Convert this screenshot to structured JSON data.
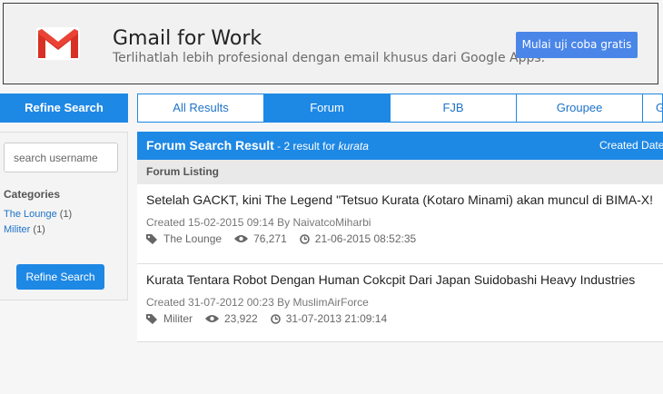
{
  "ad": {
    "title": "Gmail for Work",
    "subtitle": "Terlihatlah lebih profesional dengan email khusus dari Google Apps.",
    "cta": "Mulai uji coba gratis",
    "logo_icon": "gmail-logo"
  },
  "sidebar": {
    "header": "Refine Search",
    "search_placeholder": "search username",
    "categories_title": "Categories",
    "categories": [
      {
        "name": "The Lounge",
        "count": "(1)"
      },
      {
        "name": "Militer",
        "count": "(1)"
      }
    ],
    "button": "Refine Search"
  },
  "tabs": [
    {
      "label": "All Results",
      "active": false
    },
    {
      "label": "Forum",
      "active": true
    },
    {
      "label": "FJB",
      "active": false
    },
    {
      "label": "Groupee",
      "active": false
    },
    {
      "label": "G",
      "active": false
    }
  ],
  "results": {
    "title": "Forum Search Result",
    "count_text": " - 2 result for ",
    "keyword": "kurata",
    "sort_label": "Created Date",
    "listing_label": "Forum Listing",
    "threads": [
      {
        "title": "Setelah GACKT, kini The Legend \"Tetsuo Kurata (Kotaro Minami) akan muncul di BIMA-X!",
        "created": "Created 15-02-2015 09:14 By NaivatcoMiharbi",
        "category": "The Lounge",
        "views": "76,271",
        "last_post": "21-06-2015 08:52:35"
      },
      {
        "title": "Kurata Tentara Robot Dengan Human Cokcpit Dari Japan Suidobashi Heavy Industries",
        "created": "Created 31-07-2012 00:23 By MuslimAirForce",
        "category": "Militer",
        "views": "23,922",
        "last_post": "31-07-2013 21:09:14"
      }
    ]
  },
  "colors": {
    "accent": "#1e88e5",
    "ad_button": "#4a86e8",
    "link": "#1e73c8"
  }
}
